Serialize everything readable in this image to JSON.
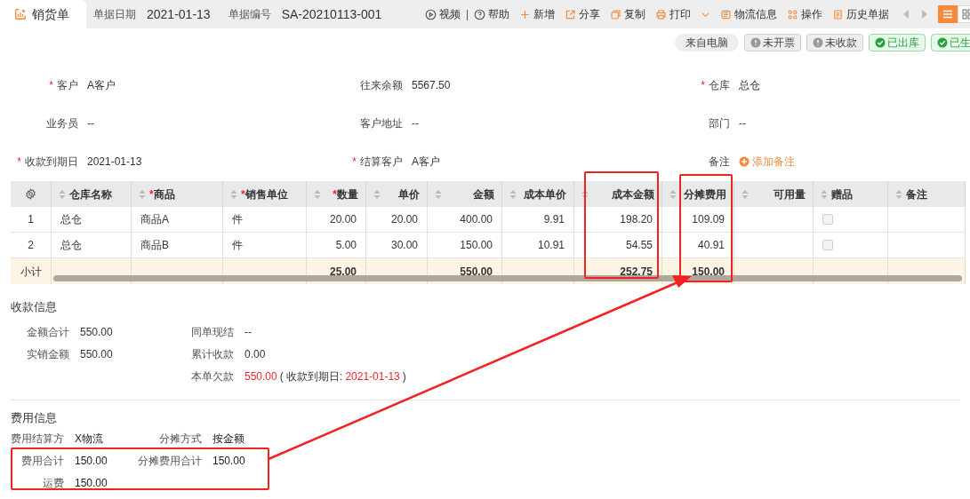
{
  "required_mark": "*",
  "header": {
    "tab": "销货单",
    "date_label": "单据日期",
    "date": "2021-01-13",
    "number_label": "单据编号",
    "number": "SA-20210113-001"
  },
  "toolbar": [
    {
      "kind": "video",
      "label": "视频"
    },
    {
      "kind": "separator",
      "label": "|"
    },
    {
      "kind": "help",
      "label": "帮助"
    },
    {
      "kind": "add",
      "label": "新增"
    },
    {
      "kind": "share",
      "label": "分享"
    },
    {
      "kind": "copy",
      "label": "复制"
    },
    {
      "kind": "print",
      "label": "打印"
    },
    {
      "kind": "logistics",
      "label": "物流信息"
    },
    {
      "kind": "operate",
      "label": "操作"
    },
    {
      "kind": "history",
      "label": "历史单据"
    }
  ],
  "view_toggle": [
    {
      "kind": "list",
      "selected": true
    },
    {
      "kind": "grid",
      "selected": false
    }
  ],
  "badges": [
    {
      "kind": "source",
      "label": "来自电脑"
    },
    {
      "kind": "warning",
      "label": "未开票"
    },
    {
      "kind": "warning",
      "label": "未收款"
    },
    {
      "kind": "success",
      "label": "已出库"
    },
    {
      "kind": "success",
      "label": "已生"
    }
  ],
  "form": [
    {
      "label": "客户",
      "required": true,
      "value": "A客户",
      "kind": "text"
    },
    {
      "label": "往来余额",
      "required": false,
      "value": "5567.50",
      "kind": "text"
    },
    {
      "label": "仓库",
      "required": true,
      "value": "总仓",
      "kind": "text"
    },
    {
      "label": "业务员",
      "required": false,
      "value": "--",
      "kind": "text"
    },
    {
      "label": "客户地址",
      "required": false,
      "value": "--",
      "kind": "text"
    },
    {
      "label": "部门",
      "required": false,
      "value": "--",
      "kind": "text"
    },
    {
      "label": "收款到期日",
      "required": true,
      "value": "2021-01-13",
      "kind": "text"
    },
    {
      "label": "结算客户",
      "required": true,
      "value": "A客户",
      "kind": "text"
    },
    {
      "label": "备注",
      "required": false,
      "value": "添加备注",
      "kind": "link"
    }
  ],
  "table": {
    "columns": [
      {
        "label": "仓库名称",
        "required": false,
        "kind": "text"
      },
      {
        "label": "商品",
        "required": true,
        "kind": "text"
      },
      {
        "label": "销售单位",
        "required": true,
        "kind": "text"
      },
      {
        "label": "数量",
        "required": true,
        "kind": "number"
      },
      {
        "label": "单价",
        "required": false,
        "kind": "number"
      },
      {
        "label": "金额",
        "required": false,
        "kind": "number"
      },
      {
        "label": "成本单价",
        "required": false,
        "kind": "number"
      },
      {
        "label": "成本金额",
        "required": false,
        "kind": "number"
      },
      {
        "label": "分摊费用",
        "required": false,
        "kind": "number"
      },
      {
        "label": "可用量",
        "required": false,
        "kind": "number"
      },
      {
        "label": "赠品",
        "required": false,
        "kind": "text"
      },
      {
        "label": "备注",
        "required": false,
        "kind": "text"
      }
    ],
    "rows": [
      {
        "no": "1",
        "warehouse": "总仓",
        "product": "商品A",
        "unit": "件",
        "quantity": "20.00",
        "price": "20.00",
        "amount": "400.00",
        "cost_price": "9.91",
        "cost_amount": "198.20",
        "allocated_fee": "109.09",
        "gift": false
      },
      {
        "no": "2",
        "warehouse": "总仓",
        "product": "商品B",
        "unit": "件",
        "quantity": "5.00",
        "price": "30.00",
        "amount": "150.00",
        "cost_price": "10.91",
        "cost_amount": "54.55",
        "allocated_fee": "40.91",
        "gift": false
      }
    ],
    "subtotal": {
      "label": "小计",
      "quantity": "25.00",
      "amount": "550.00",
      "cost_amount": "252.75",
      "allocated_fee": "150.00"
    }
  },
  "payment": {
    "title": "收款信息",
    "fields": [
      {
        "label": "金额合计",
        "parts": [
          {
            "text": "550.00",
            "highlight": false
          }
        ]
      },
      {
        "label": "同单现结",
        "parts": [
          {
            "text": "--",
            "highlight": false
          }
        ]
      },
      {
        "label": "实销金额",
        "parts": [
          {
            "text": "550.00",
            "highlight": false
          }
        ]
      },
      {
        "label": "累计收款",
        "parts": [
          {
            "text": "0.00",
            "highlight": false
          }
        ]
      },
      {
        "label": "本单欠款",
        "parts": [
          {
            "text": "550.00",
            "highlight": true
          },
          {
            "text": "( 收款到期日:",
            "highlight": false
          },
          {
            "text": "2021-01-13",
            "highlight": true
          },
          {
            "text": ")",
            "highlight": false
          }
        ]
      }
    ]
  },
  "fees": {
    "title": "费用信息",
    "fields": [
      {
        "label": "费用结算方",
        "value": "X物流"
      },
      {
        "label": "分摊方式",
        "value": "按金额"
      },
      {
        "label": "费用合计",
        "value": "150.00"
      },
      {
        "label": "分摊费用合计",
        "value": "150.00"
      },
      {
        "label": "运费",
        "value": "150.00"
      }
    ]
  }
}
